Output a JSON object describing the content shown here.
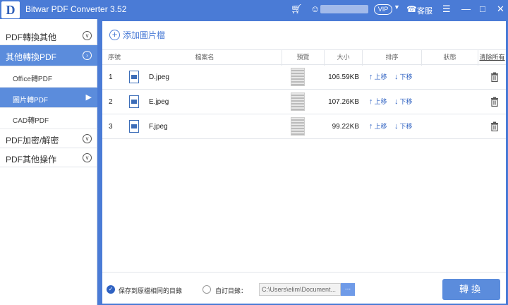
{
  "window": {
    "logo_letter": "D",
    "title": "Bitwar PDF Converter 3.52",
    "vip_label": "VIP",
    "support_label": "客服"
  },
  "sidebar": {
    "items": [
      {
        "label": "PDF轉換其他"
      },
      {
        "label": "其他轉換PDF"
      },
      {
        "label": "PDF加密/解密"
      },
      {
        "label": "PDF其他操作"
      }
    ],
    "subitems": [
      {
        "label": "Office轉PDF"
      },
      {
        "label": "圖片轉PDF"
      },
      {
        "label": "CAD轉PDF"
      }
    ],
    "active_item": "其他轉換PDF",
    "active_subitem": "圖片轉PDF"
  },
  "toolbar": {
    "add_label": "添加圖片檔"
  },
  "table": {
    "headers": {
      "index": "序號",
      "filename": "檔案名",
      "preview": "預覽",
      "size": "大小",
      "order": "排序",
      "status": "狀態",
      "clear_all": "清除所有"
    },
    "move_up_label": "上移",
    "move_down_label": "下移",
    "rows": [
      {
        "index": "1",
        "filename": "D.jpeg",
        "size": "106.59KB"
      },
      {
        "index": "2",
        "filename": "E.jpeg",
        "size": "107.26KB"
      },
      {
        "index": "3",
        "filename": "F.jpeg",
        "size": "99.22KB"
      }
    ]
  },
  "footer": {
    "same_dir_label": "保存到原檔相同的目錄",
    "custom_dir_label": "自訂目錄：",
    "path_value": "C:\\Users\\elim\\Document...",
    "browse_label": "...",
    "convert_label": "轉換"
  },
  "colors": {
    "accent": "#4a7bd6",
    "active": "#5b8cdc",
    "link": "#2f62c2"
  }
}
